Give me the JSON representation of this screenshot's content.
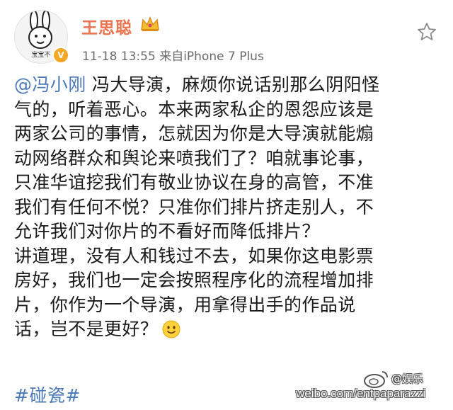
{
  "post": {
    "author": {
      "name": "王思聪",
      "avatar_caption": "宝宝不",
      "badge": "V"
    },
    "meta": "11-18 13:55  来自iPhone 7 Plus",
    "mention": "@冯小刚",
    "lines": [
      " 冯大导演，麻烦你说话别那么阴阳怪",
      "气的，听着恶心。本来两家私企的恩怨应该是",
      "两家公司的事情，怎就因为你是大导演就能煽",
      "动网络群众和舆论来喷我们了？咱就事论事，",
      "只准华谊挖我们有敬业协议在身的高管，不准",
      "我们有任何不悦？只准你们排片挤走别人，不",
      "允许我们对你片的不看好而降低排片？",
      "讲道理，没有人和钱过不去，如果你这电影票",
      "房好，我们也一定会按照程序化的流程增加排",
      "片，你作为一个导演，用拿得出手的作品说",
      "话，岂不是更好？"
    ],
    "hashtag": "#碰瓷#"
  },
  "watermark": {
    "url": "weibo.com/entpaparazzi",
    "name": "@娱乐"
  },
  "colors": {
    "username": "#eb7350",
    "link": "#4a78b8",
    "meta": "#6b6b6b",
    "verified": "#f5a623"
  },
  "icons": [
    "crown-icon",
    "star-icon",
    "smile-emoji-icon",
    "weibo-logo-icon",
    "verified-badge-icon"
  ]
}
